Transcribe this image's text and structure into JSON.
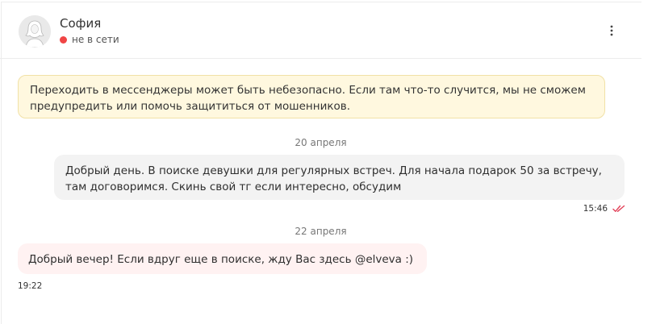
{
  "contact": {
    "name": "София",
    "status": "не в сети",
    "status_color": "#f04545"
  },
  "header": {
    "menu_icon": "more-vertical-icon"
  },
  "warning": {
    "line1": "Переходить в мессенджеры может быть небезопасно. Если там что-то случится, мы не сможем",
    "line2": "предупредить или помочь защититься от мошенников.",
    "background": "#fff8df"
  },
  "messages": [
    {
      "date": "20 апреля",
      "direction": "outgoing",
      "line1": "Добрый день. В поиске девушки для регулярных встреч. Для начала подарок 50 за встречу,",
      "line2": "там договоримся. Скинь свой тг если интересно, обсудим",
      "time": "15:46",
      "read": true,
      "read_icon": "double-check-icon",
      "read_color": "#e2435a"
    },
    {
      "date": "22 апреля",
      "direction": "incoming",
      "line1": "Добрый вечер! Если вдруг еще в поиске, жду Вас здесь @elveva :)",
      "time": "19:22"
    }
  ]
}
